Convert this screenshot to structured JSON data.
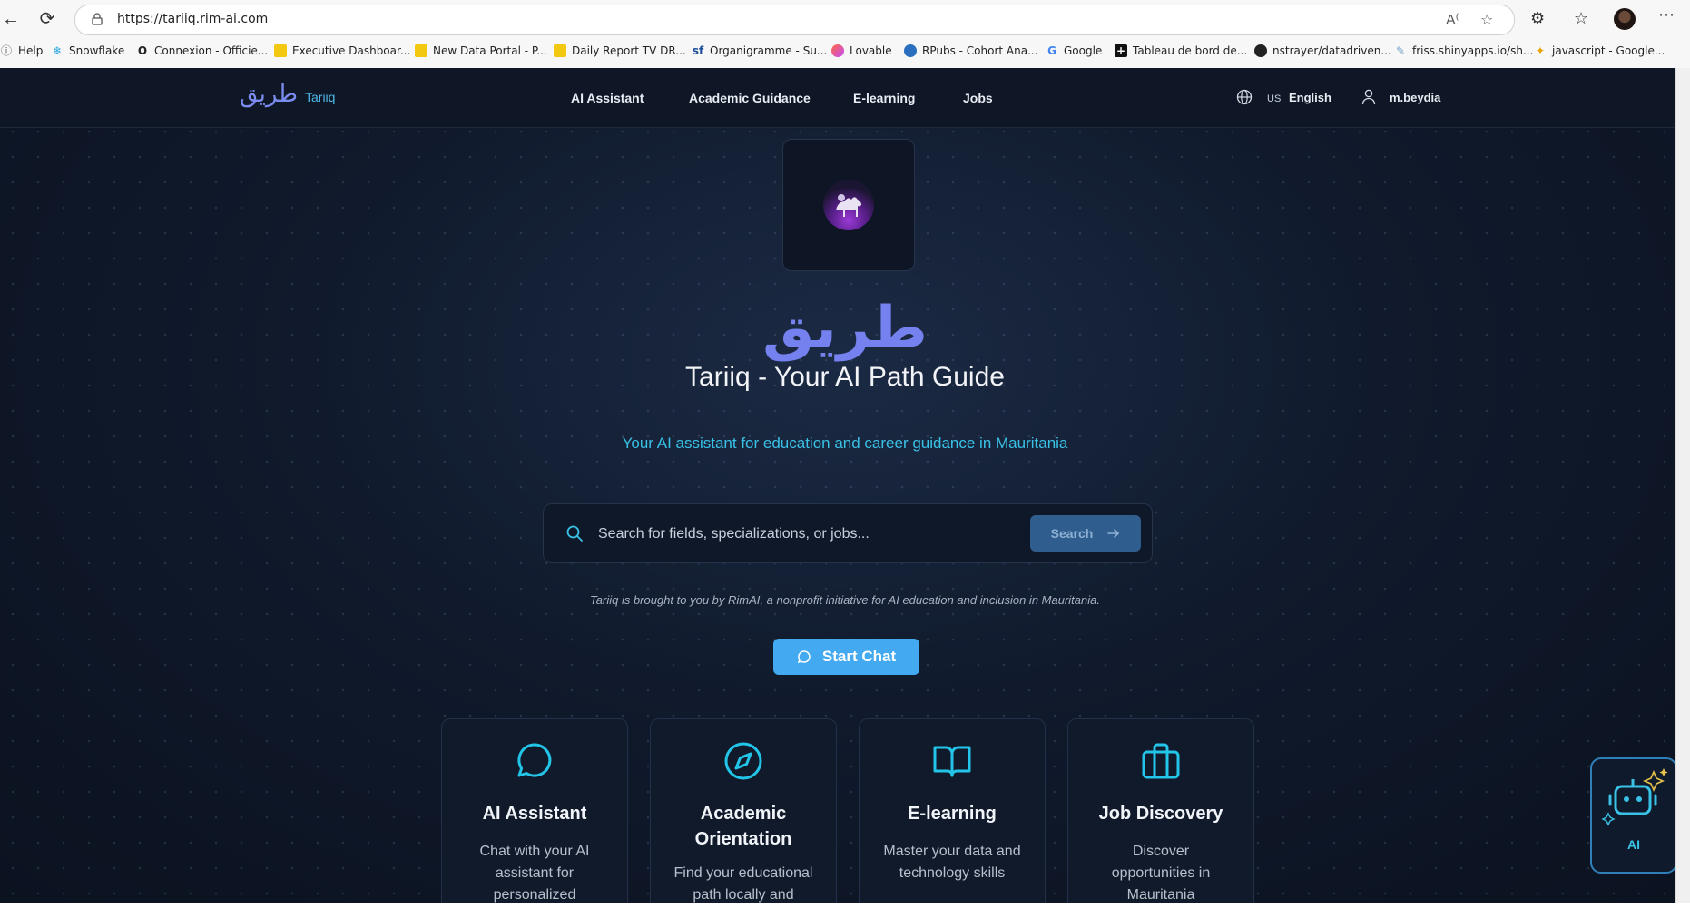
{
  "browser": {
    "url": "https://tariiq.rim-ai.com",
    "bookmarks": [
      {
        "label": "Help",
        "icon": "help-icon"
      },
      {
        "label": "Snowflake",
        "icon": "snowflake-icon"
      },
      {
        "label": "Connexion - Officie...",
        "icon": "o-icon"
      },
      {
        "label": "Executive Dashboar...",
        "icon": "powerbi-icon"
      },
      {
        "label": "New Data Portal - P...",
        "icon": "powerbi-icon"
      },
      {
        "label": "Daily Report TV DR...",
        "icon": "powerbi-icon"
      },
      {
        "label": "Organigramme - Su...",
        "icon": "sf-icon"
      },
      {
        "label": "Lovable",
        "icon": "lovable-icon"
      },
      {
        "label": "RPubs - Cohort Ana...",
        "icon": "rpubs-icon"
      },
      {
        "label": "Google",
        "icon": "google-icon"
      },
      {
        "label": "Tableau de bord de...",
        "icon": "plus-icon"
      },
      {
        "label": "nstrayer/datadriven...",
        "icon": "github-icon"
      },
      {
        "label": "friss.shinyapps.io/sh...",
        "icon": "shiny-icon"
      },
      {
        "label": "javascript - Google...",
        "icon": "js-icon"
      }
    ]
  },
  "header": {
    "brand_ar": "طريق",
    "brand_en": "Tariiq",
    "menu": [
      "AI Assistant",
      "Academic Guidance",
      "E-learning",
      "Jobs"
    ],
    "lang_code": "US",
    "lang": "English",
    "username": "m.beydia"
  },
  "hero": {
    "title_ar": "طريق",
    "title": "Tariiq - Your AI Path Guide",
    "subtitle": "Your AI assistant for education and career guidance in Mauritania"
  },
  "search": {
    "placeholder": "Search for fields, specializations, or jobs...",
    "button": "Search"
  },
  "credit": "Tariiq is brought to you by RimAI, a nonprofit initiative for AI education and inclusion in Mauritania.",
  "cta": "Start Chat",
  "cards": [
    {
      "title": "AI Assistant",
      "desc": [
        "Chat with your AI",
        "assistant for",
        "personalized"
      ],
      "icon": "chat-bubble-icon"
    },
    {
      "title": "Academic Orientation",
      "desc": [
        "Find your educational",
        "path locally and"
      ],
      "icon": "compass-icon"
    },
    {
      "title": "E-learning",
      "desc": [
        "Master your data and",
        "technology skills"
      ],
      "icon": "book-icon"
    },
    {
      "title": "Job Discovery",
      "desc": [
        "Discover",
        "opportunities in",
        "Mauritania"
      ],
      "icon": "briefcase-icon"
    }
  ],
  "fab": {
    "label": "AI",
    "icon": "robot-icon"
  },
  "colors": {
    "accent": "#39c2e6",
    "brand_purple": "#7481ee",
    "cta": "#43a9f0",
    "background": "#0b1220"
  }
}
